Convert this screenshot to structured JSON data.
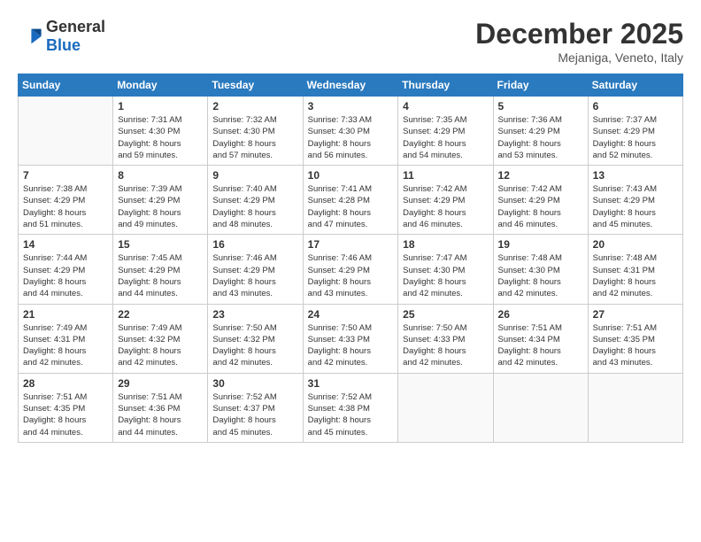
{
  "header": {
    "logo_general": "General",
    "logo_blue": "Blue",
    "month_year": "December 2025",
    "location": "Mejaniga, Veneto, Italy"
  },
  "weekdays": [
    "Sunday",
    "Monday",
    "Tuesday",
    "Wednesday",
    "Thursday",
    "Friday",
    "Saturday"
  ],
  "weeks": [
    [
      {
        "day": "",
        "info": ""
      },
      {
        "day": "1",
        "info": "Sunrise: 7:31 AM\nSunset: 4:30 PM\nDaylight: 8 hours\nand 59 minutes."
      },
      {
        "day": "2",
        "info": "Sunrise: 7:32 AM\nSunset: 4:30 PM\nDaylight: 8 hours\nand 57 minutes."
      },
      {
        "day": "3",
        "info": "Sunrise: 7:33 AM\nSunset: 4:30 PM\nDaylight: 8 hours\nand 56 minutes."
      },
      {
        "day": "4",
        "info": "Sunrise: 7:35 AM\nSunset: 4:29 PM\nDaylight: 8 hours\nand 54 minutes."
      },
      {
        "day": "5",
        "info": "Sunrise: 7:36 AM\nSunset: 4:29 PM\nDaylight: 8 hours\nand 53 minutes."
      },
      {
        "day": "6",
        "info": "Sunrise: 7:37 AM\nSunset: 4:29 PM\nDaylight: 8 hours\nand 52 minutes."
      }
    ],
    [
      {
        "day": "7",
        "info": "Sunrise: 7:38 AM\nSunset: 4:29 PM\nDaylight: 8 hours\nand 51 minutes."
      },
      {
        "day": "8",
        "info": "Sunrise: 7:39 AM\nSunset: 4:29 PM\nDaylight: 8 hours\nand 49 minutes."
      },
      {
        "day": "9",
        "info": "Sunrise: 7:40 AM\nSunset: 4:29 PM\nDaylight: 8 hours\nand 48 minutes."
      },
      {
        "day": "10",
        "info": "Sunrise: 7:41 AM\nSunset: 4:28 PM\nDaylight: 8 hours\nand 47 minutes."
      },
      {
        "day": "11",
        "info": "Sunrise: 7:42 AM\nSunset: 4:29 PM\nDaylight: 8 hours\nand 46 minutes."
      },
      {
        "day": "12",
        "info": "Sunrise: 7:42 AM\nSunset: 4:29 PM\nDaylight: 8 hours\nand 46 minutes."
      },
      {
        "day": "13",
        "info": "Sunrise: 7:43 AM\nSunset: 4:29 PM\nDaylight: 8 hours\nand 45 minutes."
      }
    ],
    [
      {
        "day": "14",
        "info": "Sunrise: 7:44 AM\nSunset: 4:29 PM\nDaylight: 8 hours\nand 44 minutes."
      },
      {
        "day": "15",
        "info": "Sunrise: 7:45 AM\nSunset: 4:29 PM\nDaylight: 8 hours\nand 44 minutes."
      },
      {
        "day": "16",
        "info": "Sunrise: 7:46 AM\nSunset: 4:29 PM\nDaylight: 8 hours\nand 43 minutes."
      },
      {
        "day": "17",
        "info": "Sunrise: 7:46 AM\nSunset: 4:29 PM\nDaylight: 8 hours\nand 43 minutes."
      },
      {
        "day": "18",
        "info": "Sunrise: 7:47 AM\nSunset: 4:30 PM\nDaylight: 8 hours\nand 42 minutes."
      },
      {
        "day": "19",
        "info": "Sunrise: 7:48 AM\nSunset: 4:30 PM\nDaylight: 8 hours\nand 42 minutes."
      },
      {
        "day": "20",
        "info": "Sunrise: 7:48 AM\nSunset: 4:31 PM\nDaylight: 8 hours\nand 42 minutes."
      }
    ],
    [
      {
        "day": "21",
        "info": "Sunrise: 7:49 AM\nSunset: 4:31 PM\nDaylight: 8 hours\nand 42 minutes."
      },
      {
        "day": "22",
        "info": "Sunrise: 7:49 AM\nSunset: 4:32 PM\nDaylight: 8 hours\nand 42 minutes."
      },
      {
        "day": "23",
        "info": "Sunrise: 7:50 AM\nSunset: 4:32 PM\nDaylight: 8 hours\nand 42 minutes."
      },
      {
        "day": "24",
        "info": "Sunrise: 7:50 AM\nSunset: 4:33 PM\nDaylight: 8 hours\nand 42 minutes."
      },
      {
        "day": "25",
        "info": "Sunrise: 7:50 AM\nSunset: 4:33 PM\nDaylight: 8 hours\nand 42 minutes."
      },
      {
        "day": "26",
        "info": "Sunrise: 7:51 AM\nSunset: 4:34 PM\nDaylight: 8 hours\nand 42 minutes."
      },
      {
        "day": "27",
        "info": "Sunrise: 7:51 AM\nSunset: 4:35 PM\nDaylight: 8 hours\nand 43 minutes."
      }
    ],
    [
      {
        "day": "28",
        "info": "Sunrise: 7:51 AM\nSunset: 4:35 PM\nDaylight: 8 hours\nand 44 minutes."
      },
      {
        "day": "29",
        "info": "Sunrise: 7:51 AM\nSunset: 4:36 PM\nDaylight: 8 hours\nand 44 minutes."
      },
      {
        "day": "30",
        "info": "Sunrise: 7:52 AM\nSunset: 4:37 PM\nDaylight: 8 hours\nand 45 minutes."
      },
      {
        "day": "31",
        "info": "Sunrise: 7:52 AM\nSunset: 4:38 PM\nDaylight: 8 hours\nand 45 minutes."
      },
      {
        "day": "",
        "info": ""
      },
      {
        "day": "",
        "info": ""
      },
      {
        "day": "",
        "info": ""
      }
    ]
  ]
}
